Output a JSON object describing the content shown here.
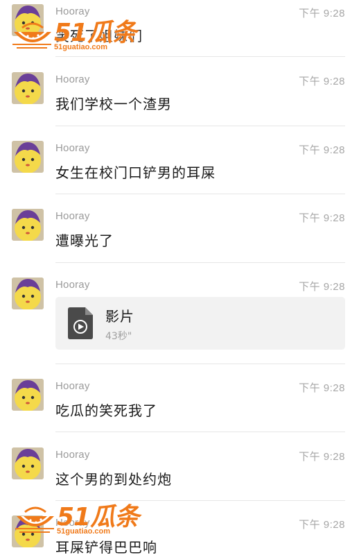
{
  "messages": [
    {
      "sender": "Hooray",
      "time": "下午 9:28",
      "text": "笑死了姐妹们"
    },
    {
      "sender": "Hooray",
      "time": "下午 9:28",
      "text": "我们学校一个渣男"
    },
    {
      "sender": "Hooray",
      "time": "下午 9:28",
      "text": "女生在校门口铲男的耳屎"
    },
    {
      "sender": "Hooray",
      "time": "下午 9:28",
      "text": "遭曝光了"
    },
    {
      "sender": "Hooray",
      "time": "下午 9:28",
      "video": {
        "title": "影片",
        "duration": "43秒\""
      }
    },
    {
      "sender": "Hooray",
      "time": "下午 9:28",
      "text": "吃瓜的笑死我了"
    },
    {
      "sender": "Hooray",
      "time": "下午 9:28",
      "text": "这个男的到处约炮"
    },
    {
      "sender": "Hooray",
      "time": "下午 9:28",
      "text": "耳屎铲得巴巴响"
    }
  ],
  "watermark": {
    "text": "51瓜条",
    "url": "51guatiao.com"
  },
  "colors": {
    "watermark": "#f07a1a",
    "sender": "#9a9a9a",
    "time": "#a6a6a6",
    "text": "#1a1a1a",
    "card_bg": "#f2f2f2"
  }
}
